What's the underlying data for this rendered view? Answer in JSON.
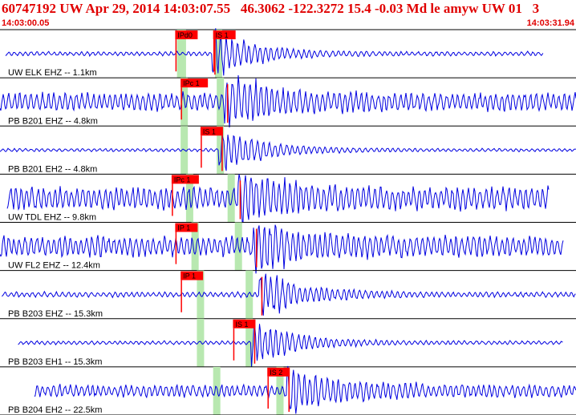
{
  "header": {
    "title": "60747192 UW Apr 29, 2014 14:03:07.55   46.3062 -122.3272 15.4 -0.03 Md le amyw UW 01   3",
    "time_start": "14:03:00.05",
    "time_end": "14:03:31.94"
  },
  "colors": {
    "trace": "#0000e0",
    "pick": "#ff0000",
    "window": "#b8e8b0",
    "divider": "#000000",
    "label": "#000000"
  },
  "chart_data": {
    "type": "line",
    "title": "60747192 UW Apr 29, 2014 14:03:07.55   46.3062 -122.3272 15.4 -0.03 Md le amyw UW 01   3",
    "x_range": [
      "14:03:00.05",
      "14:03:31.94"
    ],
    "traces": [
      {
        "label": "UW ELK EHZ -- 1.1km",
        "start": 0.3,
        "end": 30.1,
        "amp": 0.08,
        "p_pick": "IPd0",
        "p_time": 9.7,
        "s_pick": "IS 1",
        "s_time": 11.8,
        "p_win": [
          9.8,
          10.3
        ],
        "s_win": [
          11.9,
          12.3
        ],
        "event": 11.9
      },
      {
        "label": "PB B201 EHZ -- 4.8km",
        "start": 0.0,
        "end": 31.9,
        "amp": 0.35,
        "p_pick": "IPc 1",
        "p_time": 10.0,
        "s_pick": null,
        "s_time": null,
        "p_win": [
          10.0,
          10.4
        ],
        "s_win": [
          12.0,
          12.4
        ],
        "event": 12.6
      },
      {
        "label": "PB B201 EH2 -- 4.8km",
        "start": 0.0,
        "end": 31.9,
        "amp": 0.06,
        "p_pick": null,
        "p_time": null,
        "s_pick": "IS 1",
        "s_time": 11.1,
        "p_win": [
          10.0,
          10.4
        ],
        "s_win": [
          12.0,
          12.4
        ],
        "event": 12.3
      },
      {
        "label": "UW TDL EHZ -- 9.8km",
        "start": 0.4,
        "end": 30.4,
        "amp": 0.45,
        "p_pick": "IPc 1",
        "p_time": 9.5,
        "s_pick": null,
        "s_time": null,
        "p_win": [
          10.3,
          10.7
        ],
        "s_win": [
          12.6,
          13.0
        ],
        "event": 13.3
      },
      {
        "label": "UW FL2 EHZ -- 12.4km",
        "start": 0.0,
        "end": 31.2,
        "amp": 0.4,
        "p_pick": "IP 1",
        "p_time": 9.7,
        "s_pick": null,
        "s_time": null,
        "p_win": [
          10.6,
          11.0
        ],
        "s_win": [
          13.0,
          13.4
        ],
        "event": 14.2
      },
      {
        "label": "PB B203 EHZ -- 15.3km",
        "start": 0.1,
        "end": 31.9,
        "amp": 0.1,
        "p_pick": "IP 1",
        "p_time": 10.0,
        "s_pick": null,
        "s_time": null,
        "p_win": [
          10.9,
          11.3
        ],
        "s_win": [
          13.6,
          14.0
        ],
        "event": 14.5
      },
      {
        "label": "PB B203 EH1 -- 15.3km",
        "start": 1.0,
        "end": 31.2,
        "amp": 0.07,
        "p_pick": null,
        "p_time": null,
        "s_pick": "IS 1",
        "s_time": 12.9,
        "p_win": [
          10.9,
          11.3
        ],
        "s_win": [
          13.6,
          14.0
        ],
        "event": 14.1
      },
      {
        "label": "PB B204 EH2 -- 22.5km",
        "start": 1.9,
        "end": 31.9,
        "amp": 0.25,
        "p_pick": null,
        "p_time": null,
        "s_pick": "IS 2",
        "s_time": 14.8,
        "p_win": [
          11.8,
          12.2
        ],
        "s_win": [
          15.3,
          15.7
        ],
        "event": 16.0
      }
    ]
  }
}
